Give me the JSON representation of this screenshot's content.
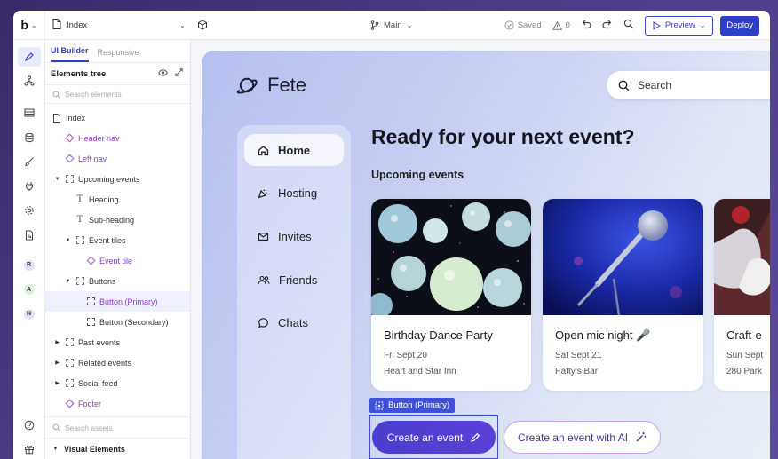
{
  "topbar": {
    "logo": "b",
    "page_name": "Index",
    "branch": "Main",
    "saved_label": "Saved",
    "warnings_count": "0",
    "preview_label": "Preview",
    "deploy_label": "Deploy"
  },
  "rail": {
    "avatars": [
      "R",
      "A",
      "N"
    ],
    "avatar_colors": [
      "#dfe3f7",
      "#d8efd9",
      "#dfe3f7"
    ]
  },
  "panel": {
    "tabs": [
      {
        "label": "UI Builder"
      },
      {
        "label": "Responsive"
      }
    ],
    "tree_title": "Elements tree",
    "search_placeholder": "Search elements",
    "tree": [
      {
        "label": "Index"
      },
      {
        "label": "Header nav"
      },
      {
        "label": "Left nav"
      },
      {
        "label": "Upcoming events"
      },
      {
        "label": "Heading"
      },
      {
        "label": "Sub-heading"
      },
      {
        "label": "Event tiles"
      },
      {
        "label": "Event tile"
      },
      {
        "label": "Buttons"
      },
      {
        "label": "Button (Primary)"
      },
      {
        "label": "Button (Secondary)"
      },
      {
        "label": "Past events"
      },
      {
        "label": "Related events"
      },
      {
        "label": "Social feed"
      },
      {
        "label": "Footer"
      }
    ],
    "assets_placeholder": "Search assets",
    "visual_elements": "Visual Elements"
  },
  "site": {
    "brand": "Fete",
    "search_label": "Search",
    "nav": [
      {
        "label": "Home"
      },
      {
        "label": "Hosting"
      },
      {
        "label": "Invites"
      },
      {
        "label": "Friends"
      },
      {
        "label": "Chats"
      }
    ],
    "headline": "Ready for your next event?",
    "subheading": "Upcoming events",
    "events": [
      {
        "title": "Birthday Dance Party",
        "date": "Fri Sept 20",
        "venue": "Heart and Star Inn"
      },
      {
        "title": "Open mic night 🎤",
        "date": "Sat Sept 21",
        "venue": "Patty's Bar"
      },
      {
        "title": "Craft-e",
        "date": "Sun Sept",
        "venue": "280 Park"
      }
    ],
    "selection_label": "Button (Primary)",
    "primary_button": "Create an event",
    "secondary_button": "Create an event with AI"
  },
  "colors": {
    "accent": "#2f3ec7",
    "selection": "#3f51d9",
    "component_purple": "#8a3fbf"
  }
}
